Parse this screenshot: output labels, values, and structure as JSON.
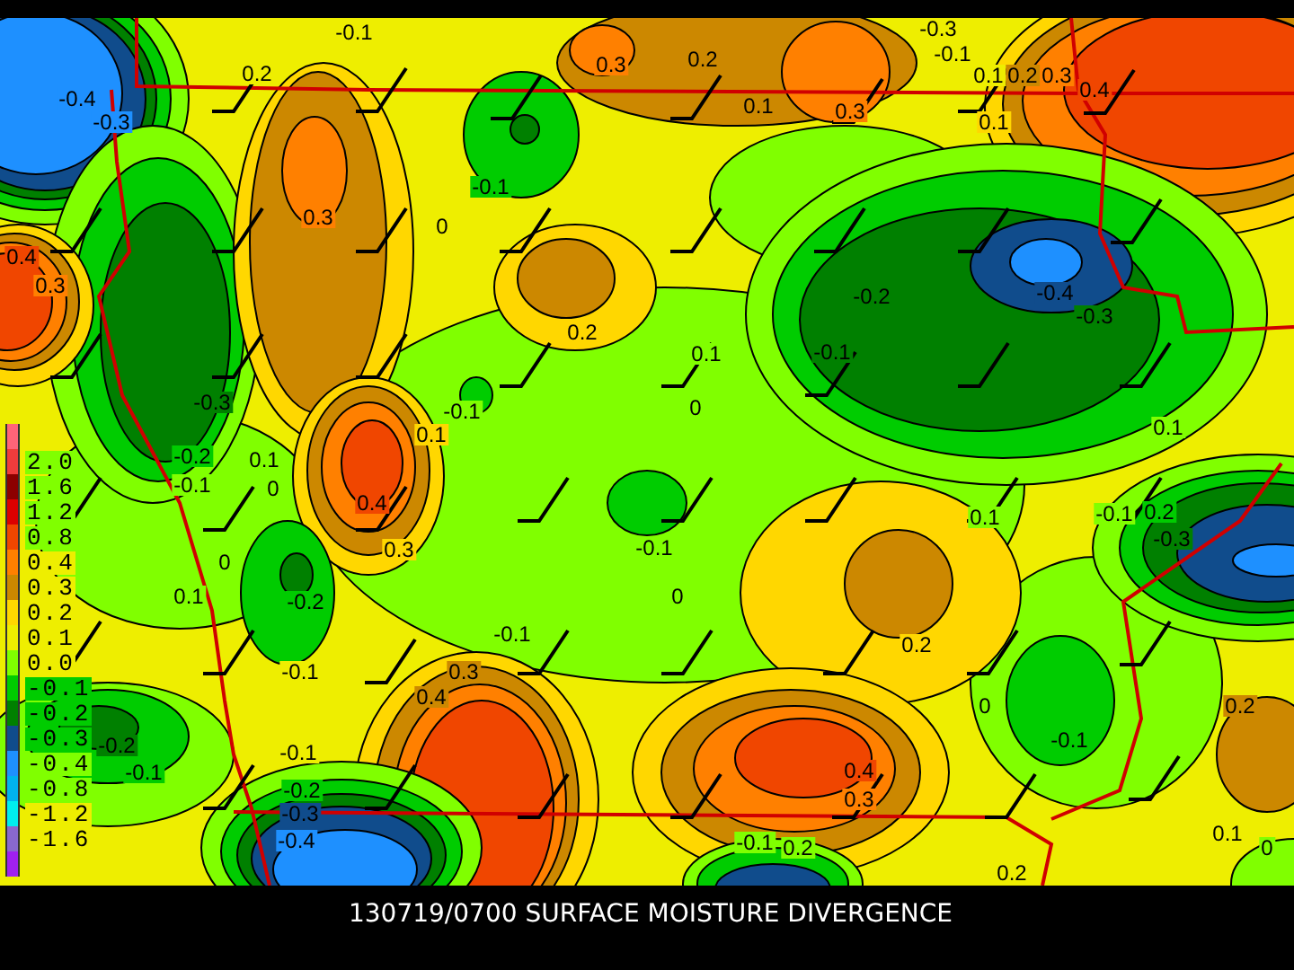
{
  "map": {
    "contour_labels": [
      "-0.1",
      "0.2",
      "0.3",
      "-0.4",
      "-0.3",
      "-0.1",
      "0.3",
      "0",
      "0.4",
      "0.3",
      "0.2",
      "-0.3",
      "-0.1",
      "0.1",
      "0.2",
      "-0.3",
      "-0.1",
      "0.1",
      "0.2",
      "0.3",
      "0.4",
      "0.1",
      "0.3",
      "0.1",
      "-0.2",
      "-0.4",
      "-0.3",
      "0.1",
      "-0.1",
      "0",
      "0.1",
      "-0.2",
      "0.1",
      "-0.1",
      "0",
      "0.4",
      "0.3",
      "0",
      "0.1",
      "-0.2",
      "-0.1",
      "-0.1",
      "0.3",
      "0.4",
      "-0.2",
      "-0.1",
      "-0.1",
      "-0.2",
      "-0.3",
      "-0.4",
      "-0.1",
      "0",
      "0.1",
      "-0.1",
      "0.2",
      "-0.3",
      "0.2",
      "0",
      "-0.1",
      "0.2",
      "0.4",
      "0.3",
      "-0.1",
      "0.2",
      "0.1",
      "0",
      "0.2"
    ]
  },
  "legend": {
    "items": [
      {
        "color": "#ff6478"
      },
      {
        "label": "2.0",
        "color": "#f03c3c"
      },
      {
        "label": "1.6",
        "color": "#8c0000"
      },
      {
        "label": "1.2",
        "color": "#dc0000"
      },
      {
        "label": "0.8",
        "color": "#f04600"
      },
      {
        "label": "0.4",
        "color": "#ff8000"
      },
      {
        "label": "0.3",
        "color": "#cc8800"
      },
      {
        "label": "0.2",
        "color": "#ffd700"
      },
      {
        "label": "0.1",
        "color": "#eeee00"
      },
      {
        "label": "0.0",
        "color": "#80ff00"
      },
      {
        "label": "-0.1",
        "color": "#00cc00"
      },
      {
        "label": "-0.2",
        "color": "#008000"
      },
      {
        "label": "-0.3",
        "color": "#104c8c"
      },
      {
        "label": "-0.4",
        "color": "#1e90ff"
      },
      {
        "label": "-0.8",
        "color": "#00b2ee"
      },
      {
        "label": "-1.2",
        "color": "#00eeee"
      },
      {
        "label": "-1.6",
        "color": "#8968cd"
      },
      {
        "color": "#a020f0"
      }
    ]
  },
  "caption": "130719/0700 SURFACE MOISTURE DIVERGENCE"
}
